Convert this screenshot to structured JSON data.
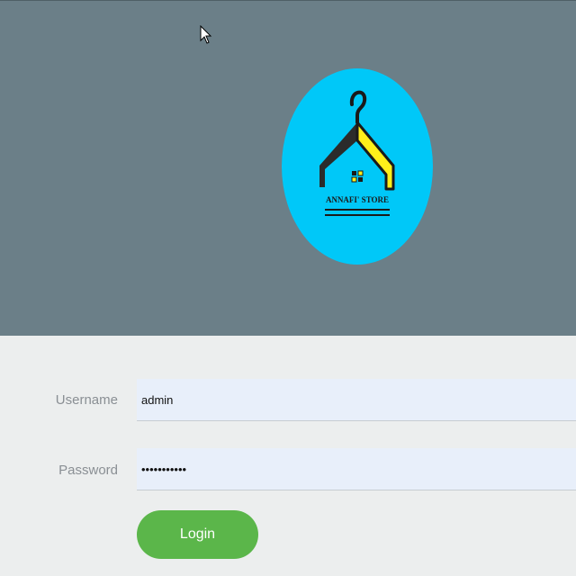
{
  "header": {
    "background_color": "#6b7f88",
    "logo": {
      "circle_color": "#00c8f8",
      "roof_color": "#ffef1a",
      "brand_text": "ANNAFI' STORE",
      "icon": "house-hanger-icon"
    },
    "cursor_icon": "mouse-pointer-icon"
  },
  "form": {
    "username_label": "Username",
    "username_value": "admin",
    "password_label": "Password",
    "password_value": "•••••••••••",
    "login_label": "Login",
    "login_color": "#5bb64a",
    "field_color": "#e8effa"
  }
}
